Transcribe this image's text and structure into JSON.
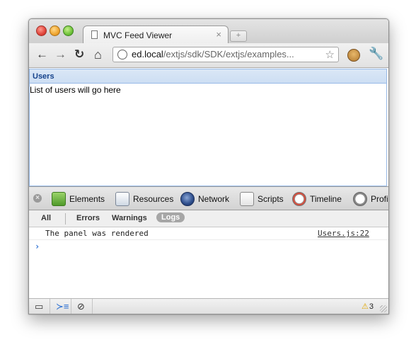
{
  "browser": {
    "tab_title": "MVC Feed Viewer",
    "tab_close": "×",
    "new_tab": "+",
    "url_host": "ed.local",
    "url_path": "/extjs/sdk/SDK/extjs/examples..."
  },
  "icons": {
    "back": "←",
    "forward": "→",
    "reload": "↻",
    "home": "⌂",
    "star": "☆",
    "wrench": "🔧"
  },
  "panel": {
    "title": "Users",
    "body": "List of users will go here"
  },
  "devtools": {
    "panels": [
      "Elements",
      "Resources",
      "Network",
      "Scripts",
      "Timeline",
      "Profi"
    ],
    "scopes": [
      "All",
      "Errors",
      "Warnings",
      "Logs"
    ],
    "selected_scope": "Logs",
    "log": {
      "message": "The panel was rendered",
      "source": "Users.js:22"
    },
    "prompt": "›",
    "warning_count": "3"
  },
  "colors": {
    "panel_header_text": "#15428b",
    "panel_border": "#99bbe8",
    "prompt": "#2a6fd3"
  }
}
